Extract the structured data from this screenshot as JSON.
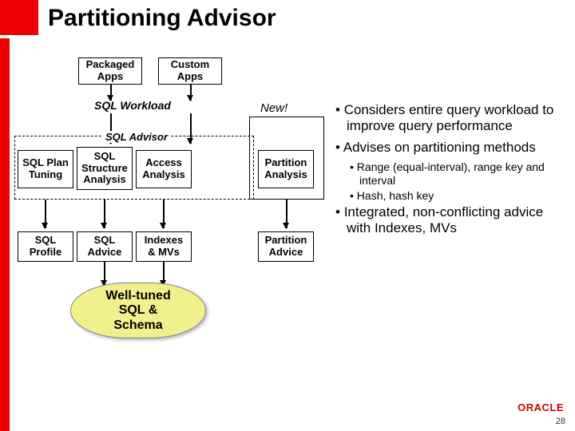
{
  "title": "Partitioning Advisor",
  "top_boxes": [
    "Packaged\nApps",
    "Custom\nApps"
  ],
  "workload_label": "SQL Workload",
  "advisor_label": "SQL Advisor",
  "new_label": "New!",
  "analysis_boxes": [
    "SQL Plan\nTuning",
    "SQL\nStructure\nAnalysis",
    "Access\nAnalysis",
    "Partition\nAnalysis"
  ],
  "output_boxes": [
    "SQL\nProfile",
    "SQL\nAdvice",
    "Indexes\n& MVs",
    "Partition\nAdvice"
  ],
  "result_blob": "Well-tuned\nSQL &\nSchema",
  "bullets": [
    {
      "level": 1,
      "text": "Considers entire query workload to improve query performance"
    },
    {
      "level": 1,
      "text": "Advises on partitioning methods"
    },
    {
      "level": 2,
      "text": "Range (equal-interval), range key and interval"
    },
    {
      "level": 2,
      "text": "Hash, hash key"
    },
    {
      "level": 1,
      "text": "Integrated, non-conflicting advice with Indexes, MVs"
    }
  ],
  "logo": "ORACLE",
  "page_number": "28"
}
